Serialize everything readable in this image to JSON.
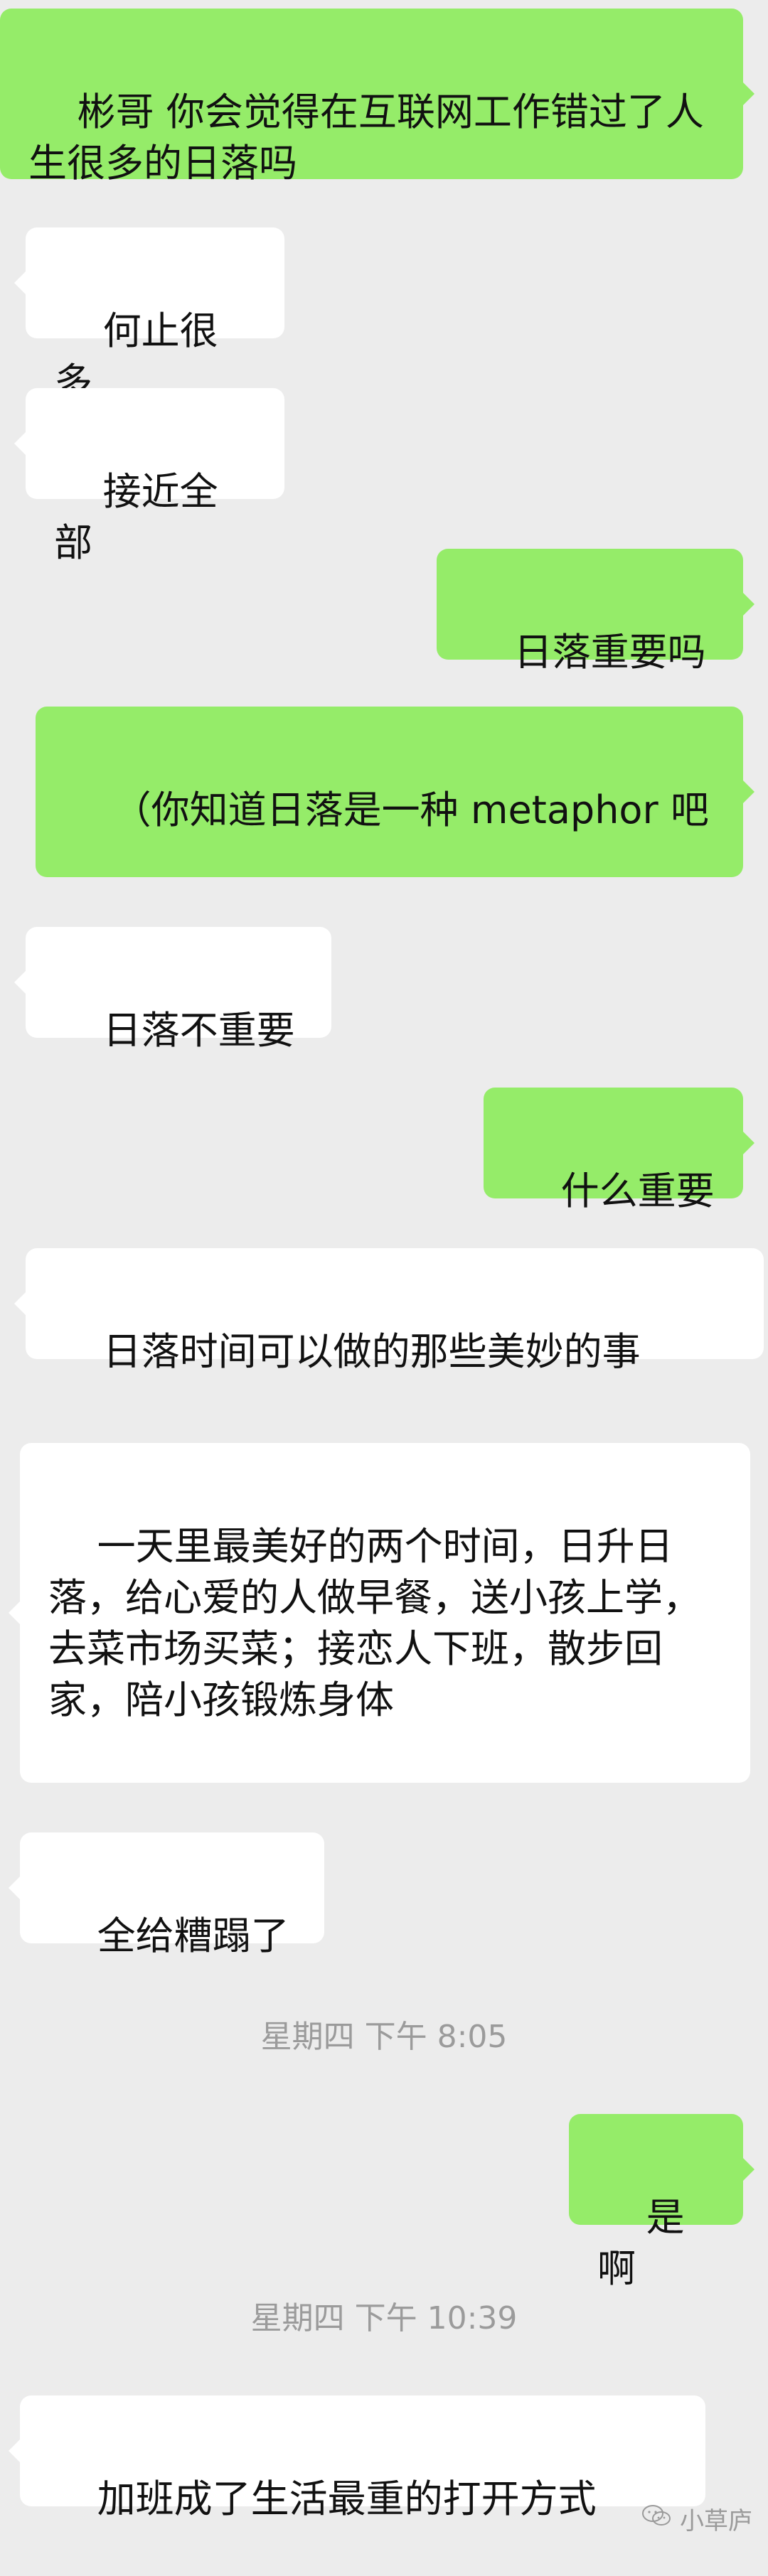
{
  "messages": [
    {
      "from": "me",
      "text": "彬哥 你会觉得在互联网工作错过了人生很多的日落吗"
    },
    {
      "from": "other",
      "text": "何止很多"
    },
    {
      "from": "other",
      "text": "接近全部"
    },
    {
      "from": "me",
      "text": "日落重要吗"
    },
    {
      "from": "me",
      "text": "（你知道日落是一种 metaphor 吧"
    },
    {
      "from": "other",
      "text": "日落不重要"
    },
    {
      "from": "me",
      "text": "什么重要"
    },
    {
      "from": "other",
      "text": "日落时间可以做的那些美妙的事"
    },
    {
      "from": "other",
      "text": "一天里最美好的两个时间，日升日落，给心爱的人做早餐，送小孩上学，去菜市场买菜；接恋人下班，散步回家，陪小孩锻炼身体"
    },
    {
      "from": "other",
      "text": "全给糟蹋了"
    },
    {
      "from": "me",
      "text": "是啊"
    },
    {
      "from": "other",
      "text": "加班成了生活最重的打开方式"
    }
  ],
  "timestamps": [
    "星期四 下午 8:05",
    "星期四 下午 10:39"
  ],
  "watermark": {
    "icon": "wechat-icon",
    "text": "小草庐"
  }
}
